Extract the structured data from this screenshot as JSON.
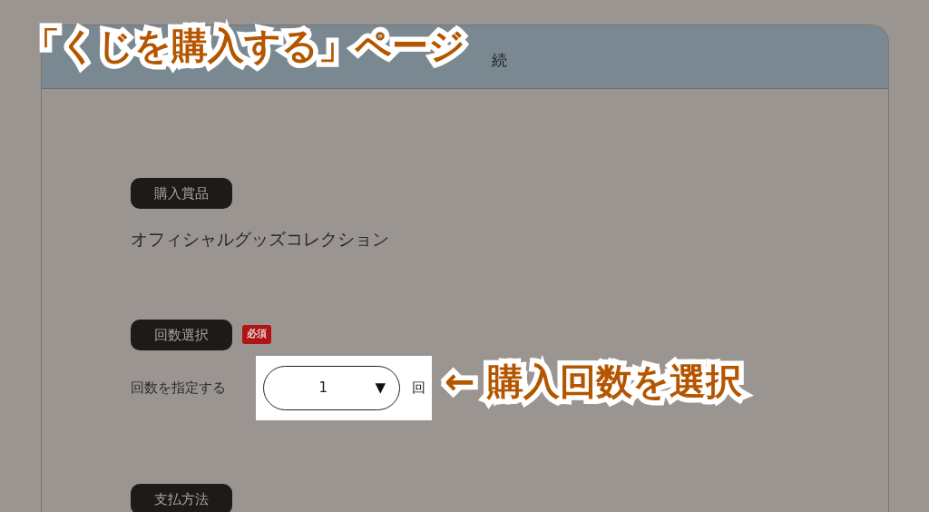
{
  "header": {
    "title": "続"
  },
  "sections": [
    {
      "kind": "text",
      "label": "購入賞品",
      "value": "オフィシャルグッズコレクション"
    },
    {
      "kind": "select",
      "label": "回数選択",
      "badge": "必須",
      "field_label": "回数を指定する",
      "value": "1",
      "caret": "▼",
      "unit": "回"
    },
    {
      "kind": "heading",
      "label": "支払方法"
    }
  ],
  "callouts": [
    {
      "kind": "page",
      "text": "「くじを購入する」ページ"
    },
    {
      "kind": "field",
      "text": "← 購入回数を選択"
    }
  ]
}
